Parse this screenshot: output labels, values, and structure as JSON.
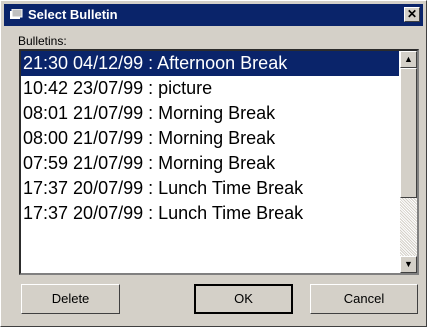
{
  "window": {
    "title": "Select Bulletin"
  },
  "list": {
    "label": "Bulletins:",
    "items": [
      "21:30 04/12/99 : Afternoon Break",
      "10:42 23/07/99 : picture",
      "08:01 21/07/99 : Morning Break",
      "08:00 21/07/99 : Morning Break",
      "07:59 21/07/99 : Morning Break",
      "17:37 20/07/99 : Lunch Time Break",
      "17:37 20/07/99 : Lunch Time Break"
    ],
    "selected_index": 0
  },
  "buttons": {
    "delete": "Delete",
    "ok": "OK",
    "cancel": "Cancel"
  },
  "icons": {
    "title": "bulletin-icon",
    "close": "close-icon",
    "scroll_up": "arrow-up-icon",
    "scroll_down": "arrow-down-icon"
  },
  "colors": {
    "titlebar": "#0a246a",
    "selection": "#0a246a",
    "face": "#d4d0c8"
  }
}
